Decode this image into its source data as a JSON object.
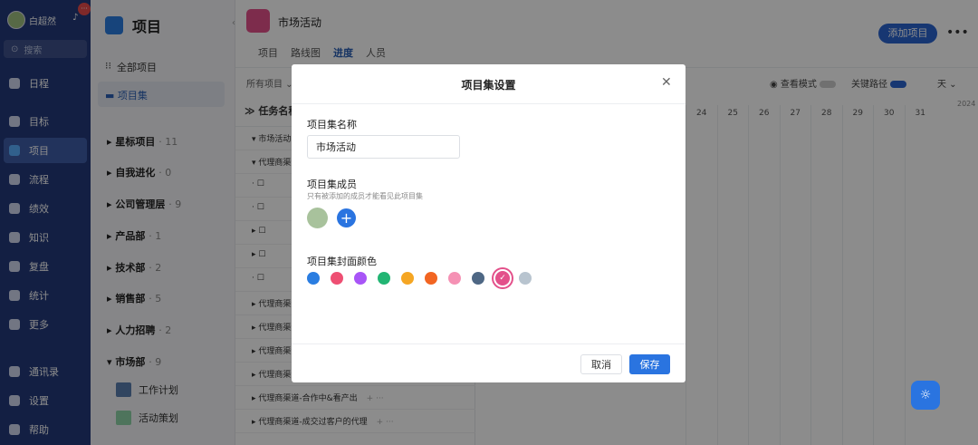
{
  "nav": {
    "user_name": "白超然",
    "badge": "···",
    "search_placeholder": "搜索",
    "items": [
      {
        "label": "日程",
        "icon": "calendar-icon"
      },
      {
        "label": "目标",
        "icon": "target-icon"
      },
      {
        "label": "项目",
        "icon": "cube-icon"
      },
      {
        "label": "流程",
        "icon": "flow-icon"
      },
      {
        "label": "绩效",
        "icon": "performance-icon"
      },
      {
        "label": "知识",
        "icon": "book-icon"
      },
      {
        "label": "复盘",
        "icon": "review-icon"
      },
      {
        "label": "统计",
        "icon": "pie-icon"
      },
      {
        "label": "更多",
        "icon": "grid-icon"
      }
    ],
    "bottom": [
      {
        "label": "通讯录",
        "icon": "contacts-icon"
      },
      {
        "label": "设置",
        "icon": "gear-icon"
      },
      {
        "label": "帮助",
        "icon": "help-icon"
      }
    ]
  },
  "project_panel": {
    "title": "项目",
    "all_projects": "全部项目",
    "project_sets": "项目集",
    "groups": [
      {
        "name": "星标项目",
        "count": "11"
      },
      {
        "name": "自我进化",
        "count": "0"
      },
      {
        "name": "公司管理层",
        "count": "9"
      },
      {
        "name": "产品部",
        "count": "1"
      },
      {
        "name": "技术部",
        "count": "2"
      },
      {
        "name": "销售部",
        "count": "5"
      },
      {
        "name": "人力招聘",
        "count": "2"
      },
      {
        "name": "市场部",
        "count": "9"
      }
    ],
    "subitems": [
      {
        "label": "工作计划"
      },
      {
        "label": "活动策划"
      }
    ]
  },
  "main": {
    "project_title": "市场活动",
    "tabs": [
      "项目",
      "路线图",
      "进度",
      "人员"
    ],
    "active_tab": "进度",
    "add_project_label": "添加项目",
    "more_label": "•••",
    "filter_label": "所有项目",
    "view_mode_label": "查看模式",
    "critical_path_label": "关键路径",
    "day_label": "天",
    "year_label": "2024",
    "task_column_header": "任务名称",
    "rows": [
      "市场活动",
      "代理商渠道",
      "代理商渠道",
      "代理商渠道",
      "代理商渠道",
      "代理商渠道",
      "代理商渠道-合作中&看产出",
      "代理商渠道-成交过客户的代理"
    ],
    "dates": [
      "24",
      "25",
      "26",
      "27",
      "28",
      "29",
      "30",
      "31"
    ]
  },
  "modal": {
    "title": "项目集设置",
    "name_label": "项目集名称",
    "name_value": "市场活动",
    "members_label": "项目集成员",
    "members_hint": "只有被添加的成员才能看见此项目集",
    "add_member": "+",
    "color_label": "项目集封面颜色",
    "colors": [
      "#2a7de1",
      "#ee4f73",
      "#a855f7",
      "#22b573",
      "#f5a623",
      "#f26522",
      "#f591b4",
      "#4e6784",
      "#e3508a",
      "#b8c4cf"
    ],
    "selected_color_index": 8,
    "cancel_label": "取消",
    "save_label": "保存"
  }
}
